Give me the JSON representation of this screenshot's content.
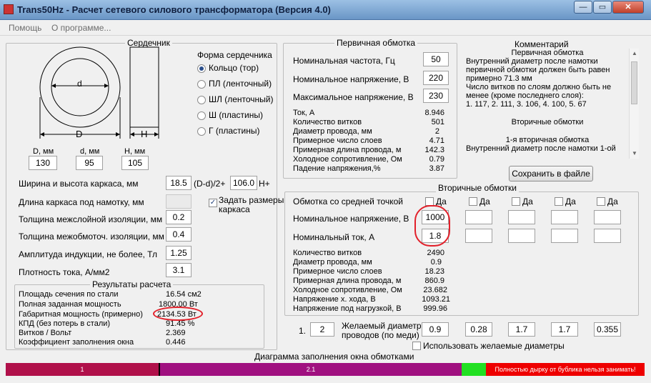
{
  "window": {
    "title": "Trans50Hz - Расчет сетевого силового трансформатора (Версия 4.0)",
    "btn_min": "—",
    "btn_max": "▭",
    "btn_close": "✕"
  },
  "menu": [
    "Помощь",
    "О программе..."
  ],
  "core": {
    "title": "Сердечник",
    "drawing": {
      "label_d": "d",
      "label_D": "D",
      "label_H": "H"
    },
    "shape_title": "Форма сердечника",
    "shapes": [
      {
        "label": "Кольцо  (тор)",
        "selected": true
      },
      {
        "label": "ПЛ  (ленточный)",
        "selected": false
      },
      {
        "label": "ШЛ  (ленточный)",
        "selected": false
      },
      {
        "label": "Ш  (пластины)",
        "selected": false
      },
      {
        "label": "Г  (пластины)",
        "selected": false
      }
    ],
    "dims": [
      {
        "label": "D, мм",
        "value": "130"
      },
      {
        "label": "d, мм",
        "value": "95"
      },
      {
        "label": "H, мм",
        "value": "105"
      }
    ],
    "frame_label": "Ширина и высота каркаса, мм",
    "frame_w": "18.5",
    "frame_formula": "(D-d)/2+",
    "frame_h": "106.0",
    "frame_suffix": "H+",
    "wind_len_label": "Длина каркаса под намотку, мм",
    "set_frame_label_1": "Задать размеры",
    "set_frame_label_2": "каркаса",
    "params": [
      {
        "label": "Толщина межслойной изоляции, мм",
        "value": "0.2"
      },
      {
        "label": "Толщина межобмоточ. изоляции, мм",
        "value": "0.4"
      },
      {
        "label": "Амплитуда индукции, не более, Тл",
        "value": "1.25"
      },
      {
        "label": "Плотность тока, А/мм2",
        "value": "3.1"
      }
    ],
    "results_title": "Результаты расчета",
    "results": [
      {
        "label": "Площадь сечения по стали",
        "value": "16.54 см2"
      },
      {
        "label": "Полная заданная мощность",
        "value": "1800.00 Вт"
      },
      {
        "label": "Габаритная мощность (примерно)",
        "value": "2134.53 Вт"
      },
      {
        "label": "КПД (без потерь в стали)",
        "value": "91.45 %"
      },
      {
        "label": "Витков / Вольт",
        "value": "2.369"
      },
      {
        "label": "Коэффициент заполнения окна",
        "value": "0.446"
      }
    ]
  },
  "primary": {
    "title": "Первичная обмотка",
    "inputs": [
      {
        "label": "Номинальная частота, Гц",
        "value": "50"
      },
      {
        "label": "Номинальное напряжение, В",
        "value": "220"
      },
      {
        "label": "Максимальное напряжение, В",
        "value": "230"
      }
    ],
    "results": [
      {
        "label": "Ток, А",
        "value": "8.946"
      },
      {
        "label": "Количество витков",
        "value": "501"
      },
      {
        "label": "Диаметр провода, мм",
        "value": "2"
      },
      {
        "label": "Примерное число слоев",
        "value": "4.71"
      },
      {
        "label": "Примерная длина провода, м",
        "value": "142.3"
      },
      {
        "label": "Холодное сопротивление, Ом",
        "value": "0.79"
      },
      {
        "label": "Падение напряжения,%",
        "value": "3.87"
      }
    ]
  },
  "comment": {
    "title": "Комментарий",
    "lines": [
      "Первичная обмотка",
      "Внутренний диаметр после намотки",
      "первичной обмотки должен быть равен",
      "примерно 71.3 мм",
      "Число витков по слоям должно быть не",
      "менее (кроме последнего слоя):",
      "1. 117, 2. 111, 3. 106, 4. 100, 5. 67",
      "",
      "Вторичные обмотки",
      "",
      "1-я вторичная обмотка",
      "Внутренний диаметр после намотки 1-ой"
    ],
    "save_button": "Сохранить в файле"
  },
  "secondary": {
    "title": "Вторичные обмотки",
    "center_tap_label": "Обмотка со средней точкой",
    "da": "Да",
    "voltage_label": "Номинальное напряжение, В",
    "current_label": "Номинальный ток, А",
    "voltages": [
      "1000",
      "",
      "",
      "",
      ""
    ],
    "currents": [
      "1.8",
      "",
      "",
      "",
      ""
    ],
    "results": [
      {
        "label": "Количество витков",
        "value": "2490"
      },
      {
        "label": "Диаметр провода, мм",
        "value": "0.9"
      },
      {
        "label": "Примерное число слоев",
        "value": "18.23"
      },
      {
        "label": "Примерная длина провода, м",
        "value": "860.9"
      },
      {
        "label": "Холодное сопротивление, Ом",
        "value": "23.682"
      },
      {
        "label": "Напряжение х. хода, В",
        "value": "1093.21"
      },
      {
        "label": "Напряжение под нагрузкой, В",
        "value": "999.96"
      }
    ]
  },
  "desired": {
    "index_label": "1.",
    "index_value": "2",
    "label_1": "Желаемый диаметр",
    "label_2": "проводов  (по меди)",
    "values": [
      "0.9",
      "0.28",
      "1.7",
      "1.7",
      "0.355"
    ],
    "use_label": "Использовать желаемые диаметры"
  },
  "fill_diagram": {
    "title": "Диаграмма заполнения окна обмотками",
    "segments": [
      {
        "label": "1",
        "color": "#b0104a"
      },
      {
        "label": "2.1",
        "color": "#a01080"
      },
      {
        "label": "",
        "color": "#22e022"
      },
      {
        "label": "Полностью дырку от бублика нельзя занимать!",
        "color": "#ee0000"
      }
    ]
  },
  "colors": {
    "annotation": "#e2202a",
    "accent": "#2a4e8c"
  }
}
